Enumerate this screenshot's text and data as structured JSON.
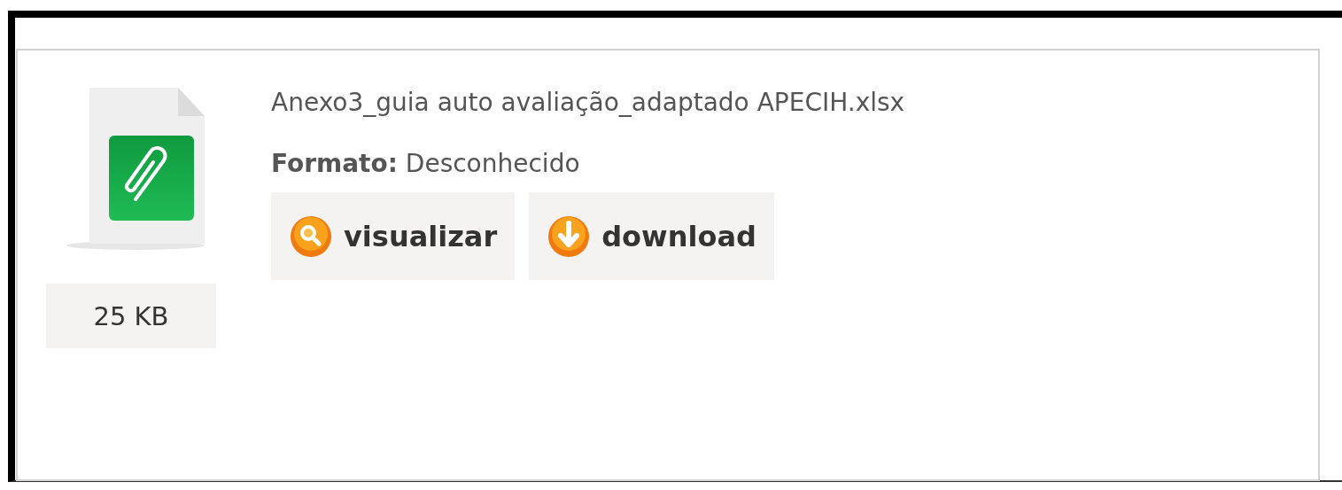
{
  "file": {
    "name": "Anexo3_guia auto avaliação_adaptado APECIH.xlsx",
    "size": "25 KB",
    "format": "**Formato:** Desconhecido"
  },
  "actions": [
    {
      "kind": "view",
      "label": "visualizar"
    },
    {
      "kind": "download",
      "label": "download"
    }
  ]
}
